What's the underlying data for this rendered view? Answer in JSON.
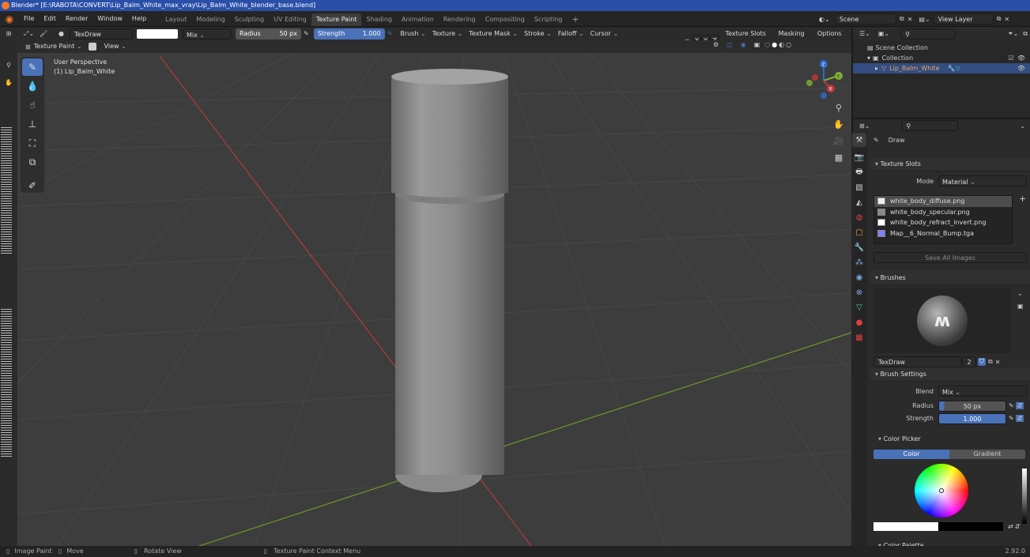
{
  "window": {
    "title": "Blender* [E:\\RABOTA\\CONVERT\\Lip_Balm_White_max_vray\\Lip_Balm_White_blender_base.blend]"
  },
  "menu": [
    "File",
    "Edit",
    "Render",
    "Window",
    "Help"
  ],
  "workspaces": [
    "Layout",
    "Modeling",
    "Sculpting",
    "UV Editing",
    "Texture Paint",
    "Shading",
    "Animation",
    "Rendering",
    "Compositing",
    "Scripting"
  ],
  "active_workspace": "Texture Paint",
  "scene": {
    "label": "Scene",
    "view_layer": "View Layer"
  },
  "tool_header": {
    "brush_name": "TexDraw",
    "blend": "Mix",
    "radius_label": "Radius",
    "radius_value": "50 px",
    "strength_label": "Strength",
    "strength_value": "1.000",
    "menus": [
      "Brush",
      "Texture",
      "Texture Mask",
      "Stroke",
      "Falloff",
      "Cursor"
    ],
    "right_menus": [
      "Texture Slots",
      "Masking",
      "Options"
    ],
    "xyz": [
      "X",
      "Y",
      "Z"
    ]
  },
  "view_header": {
    "mode": "Texture Paint",
    "view": "View"
  },
  "viewport": {
    "perspective": "User Perspective",
    "object": "(1) Lip_Balm_White"
  },
  "outliner": {
    "scene_collection": "Scene Collection",
    "collection": "Collection",
    "object": "Lip_Balm_White"
  },
  "props": {
    "draw_label": "Draw",
    "texture_slots": {
      "title": "Texture Slots",
      "mode_label": "Mode",
      "mode_value": "Material",
      "items": [
        {
          "name": "white_body_diffuse.png",
          "color": "#f0f0f0",
          "selected": true
        },
        {
          "name": "white_body_specular.png",
          "color": "#888888"
        },
        {
          "name": "white_body_refract_invert.png",
          "color": "#ffffff"
        },
        {
          "name": "Map__6_Normal_Bump.tga",
          "color": "#8080ff"
        }
      ],
      "save_all": "Save All Images"
    },
    "brushes": {
      "title": "Brushes",
      "name": "TexDraw",
      "users": "2"
    },
    "brush_settings": {
      "title": "Brush Settings",
      "blend_label": "Blend",
      "blend_value": "Mix",
      "radius_label": "Radius",
      "radius_value": "50 px",
      "strength_label": "Strength",
      "strength_value": "1.000"
    },
    "color_picker": {
      "title": "Color Picker",
      "tab_color": "Color",
      "tab_gradient": "Gradient"
    },
    "color_palette": "Color Palette"
  },
  "statusbar": {
    "items": [
      "Image Paint",
      "Move",
      "Rotate View",
      "Texture Paint Context Menu"
    ],
    "version": "2.92.0"
  },
  "colors": {
    "accent": "#4a72b9",
    "x_axis": "#c0393b",
    "y_axis": "#7fb12e"
  }
}
